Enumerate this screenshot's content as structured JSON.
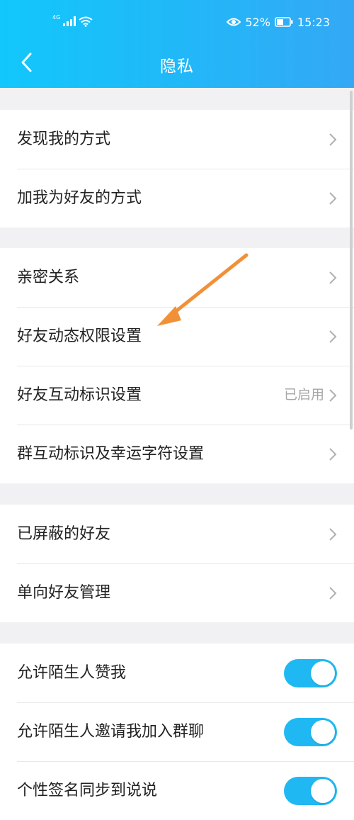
{
  "status_bar": {
    "network": "4G",
    "battery": "52%",
    "time": "15:23"
  },
  "header": {
    "title": "隐私"
  },
  "groups": [
    {
      "items": [
        {
          "label": "发现我的方式"
        },
        {
          "label": "加我为好友的方式"
        }
      ]
    },
    {
      "items": [
        {
          "label": "亲密关系"
        },
        {
          "label": "好友动态权限设置"
        },
        {
          "label": "好友互动标识设置",
          "value": "已启用"
        },
        {
          "label": "群互动标识及幸运字符设置"
        }
      ]
    },
    {
      "items": [
        {
          "label": "已屏蔽的好友"
        },
        {
          "label": "单向好友管理"
        }
      ]
    },
    {
      "items": [
        {
          "label": "允许陌生人赞我",
          "toggle": true
        },
        {
          "label": "允许陌生人邀请我加入群聊",
          "toggle": true
        },
        {
          "label": "个性签名同步到说说",
          "toggle": true
        }
      ]
    }
  ],
  "colors": {
    "header_start": "#12c7fb",
    "header_end": "#34a8f5",
    "toggle_on": "#1fb8f3",
    "annotation_arrow": "#f0913a"
  }
}
